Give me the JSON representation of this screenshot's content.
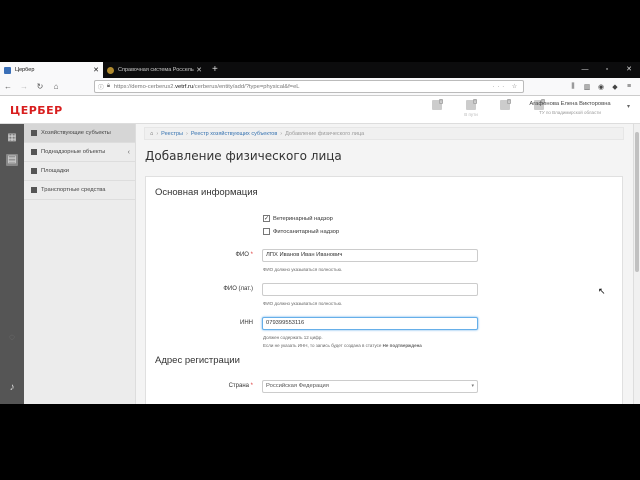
{
  "browser": {
    "tabs": [
      {
        "label": "Цербер",
        "active": true
      },
      {
        "label": "Справочная система Россельх",
        "active": false
      }
    ],
    "new_tab": "+",
    "url_prefix": "https://demo-cerberus2.",
    "url_host": "vetrf.ru",
    "url_path": "/cerberus/entity/add/?type=physical&f=eL",
    "win_min": "—",
    "win_max": "▫",
    "win_close": "✕"
  },
  "app": {
    "logo": "ЦЕРБЕР",
    "header_icons": [
      {
        "name": "notifications",
        "caption": "",
        "badge": "0"
      },
      {
        "name": "tasks",
        "caption": "В пути",
        "badge": "0"
      },
      {
        "name": "messages",
        "caption": "",
        "badge": "0"
      },
      {
        "name": "inbox",
        "caption": "",
        "badge": "0"
      }
    ],
    "user_name": "Агафонова Елена Викторовна",
    "user_org": "ТУ по Владимирской области"
  },
  "sidebar": {
    "items": [
      {
        "label": "Хозяйствующие субъекты",
        "active": true
      },
      {
        "label": "Поднадзорные объекты",
        "active": false,
        "chevron": "‹"
      },
      {
        "label": "Площадки",
        "active": false
      },
      {
        "label": "Транспортные средства",
        "active": false
      }
    ]
  },
  "breadcrumb": {
    "home": "⌂",
    "items": [
      "Реестры",
      "Реестр хозяйствующих субъектов"
    ],
    "current": "Добавление физического лица"
  },
  "page": {
    "title": "Добавление физического лица",
    "section_main": "Основная информация",
    "check_vet": "Ветеринарный надзор",
    "check_phyto": "Фитосанитарный надзор",
    "fio_label": "ФИО",
    "fio_value": "ЛПХ Иванов Иван Иванович",
    "fio_hint": "ФИО должно указываться полностью.",
    "fio_lat_label": "ФИО (лат.)",
    "fio_lat_value": "",
    "fio_lat_hint": "ФИО должно указываться полностью.",
    "inn_label": "ИНН",
    "inn_value": "079399553116",
    "inn_hint1": "Должен содержать 12 цифр.",
    "inn_hint2_a": "Если не указать ИНН, то запись будет создана в статусе ",
    "inn_hint2_b": "Не подтверждена",
    "section_addr": "Адрес регистрации",
    "country_label": "Страна",
    "country_value": "Российская Федерация"
  }
}
